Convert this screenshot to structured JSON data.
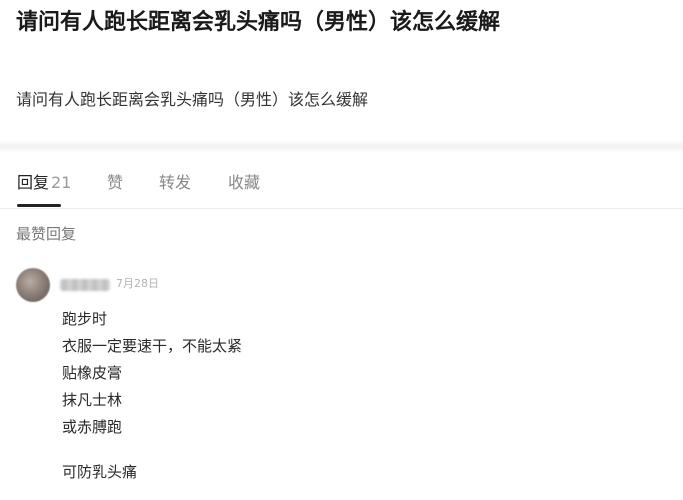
{
  "question": {
    "title": "请问有人跑长距离会乳头痛吗（男性）该怎么缓解",
    "body": "请问有人跑长距离会乳头痛吗（男性）该怎么缓解"
  },
  "tabs": [
    {
      "label": "回复",
      "count": "21",
      "active": true
    },
    {
      "label": "赞",
      "count": "",
      "active": false
    },
    {
      "label": "转发",
      "count": "",
      "active": false
    },
    {
      "label": "收藏",
      "count": "",
      "active": false
    }
  ],
  "section": {
    "label": "最赞回复"
  },
  "reply": {
    "date": "7月28日",
    "lines": [
      "跑步时",
      "衣服一定要速干，不能太紧",
      "贴橡皮膏",
      "抹凡士林",
      "或赤膊跑",
      "可防乳头痛"
    ]
  }
}
